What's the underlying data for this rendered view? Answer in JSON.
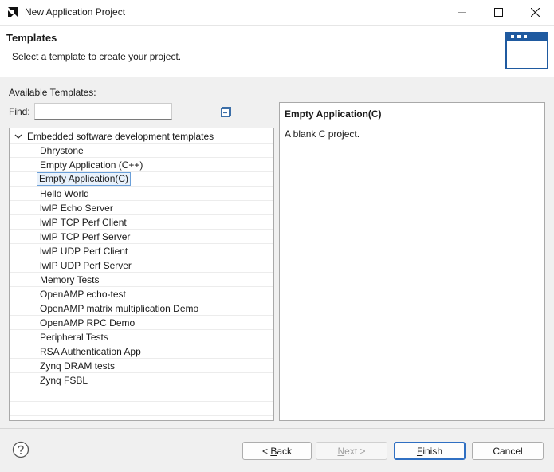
{
  "window": {
    "title": "New Application Project"
  },
  "header": {
    "title": "Templates",
    "description": "Select a template to create your project."
  },
  "templates": {
    "label": "Available Templates:",
    "find_label": "Find:",
    "find_value": "",
    "category": "Embedded software development templates",
    "items": [
      "Dhrystone",
      "Empty Application (C++)",
      "Empty Application(C)",
      "Hello World",
      "lwIP Echo Server",
      "lwIP TCP Perf Client",
      "lwIP TCP Perf Server",
      "lwIP UDP Perf Client",
      "lwIP UDP Perf Server",
      "Memory Tests",
      "OpenAMP echo-test",
      "OpenAMP matrix multiplication Demo",
      "OpenAMP RPC Demo",
      "Peripheral Tests",
      "RSA Authentication App",
      "Zynq DRAM tests",
      "Zynq FSBL"
    ],
    "selected": "Empty Application(C)"
  },
  "description": {
    "title": "Empty Application(C)",
    "body": "A blank C project."
  },
  "buttons": {
    "back_prefix": "< ",
    "back_mnemonic": "B",
    "back_rest": "ack",
    "next_mnemonic": "N",
    "next_rest": "ext >",
    "finish_mnemonic": "F",
    "finish_rest": "inish",
    "cancel": "Cancel"
  },
  "icons": {
    "app": "amd-logo-icon",
    "minimize": "minimize-icon",
    "maximize": "maximize-icon",
    "close": "close-icon",
    "header": "window-template-icon",
    "collapse": "collapse-all-icon",
    "expander": "chevron-down-icon",
    "help": "help-icon"
  },
  "colors": {
    "accent": "#2f6fc2",
    "selection_border": "#6a9fd9",
    "header_icon": "#1f5aa0"
  }
}
